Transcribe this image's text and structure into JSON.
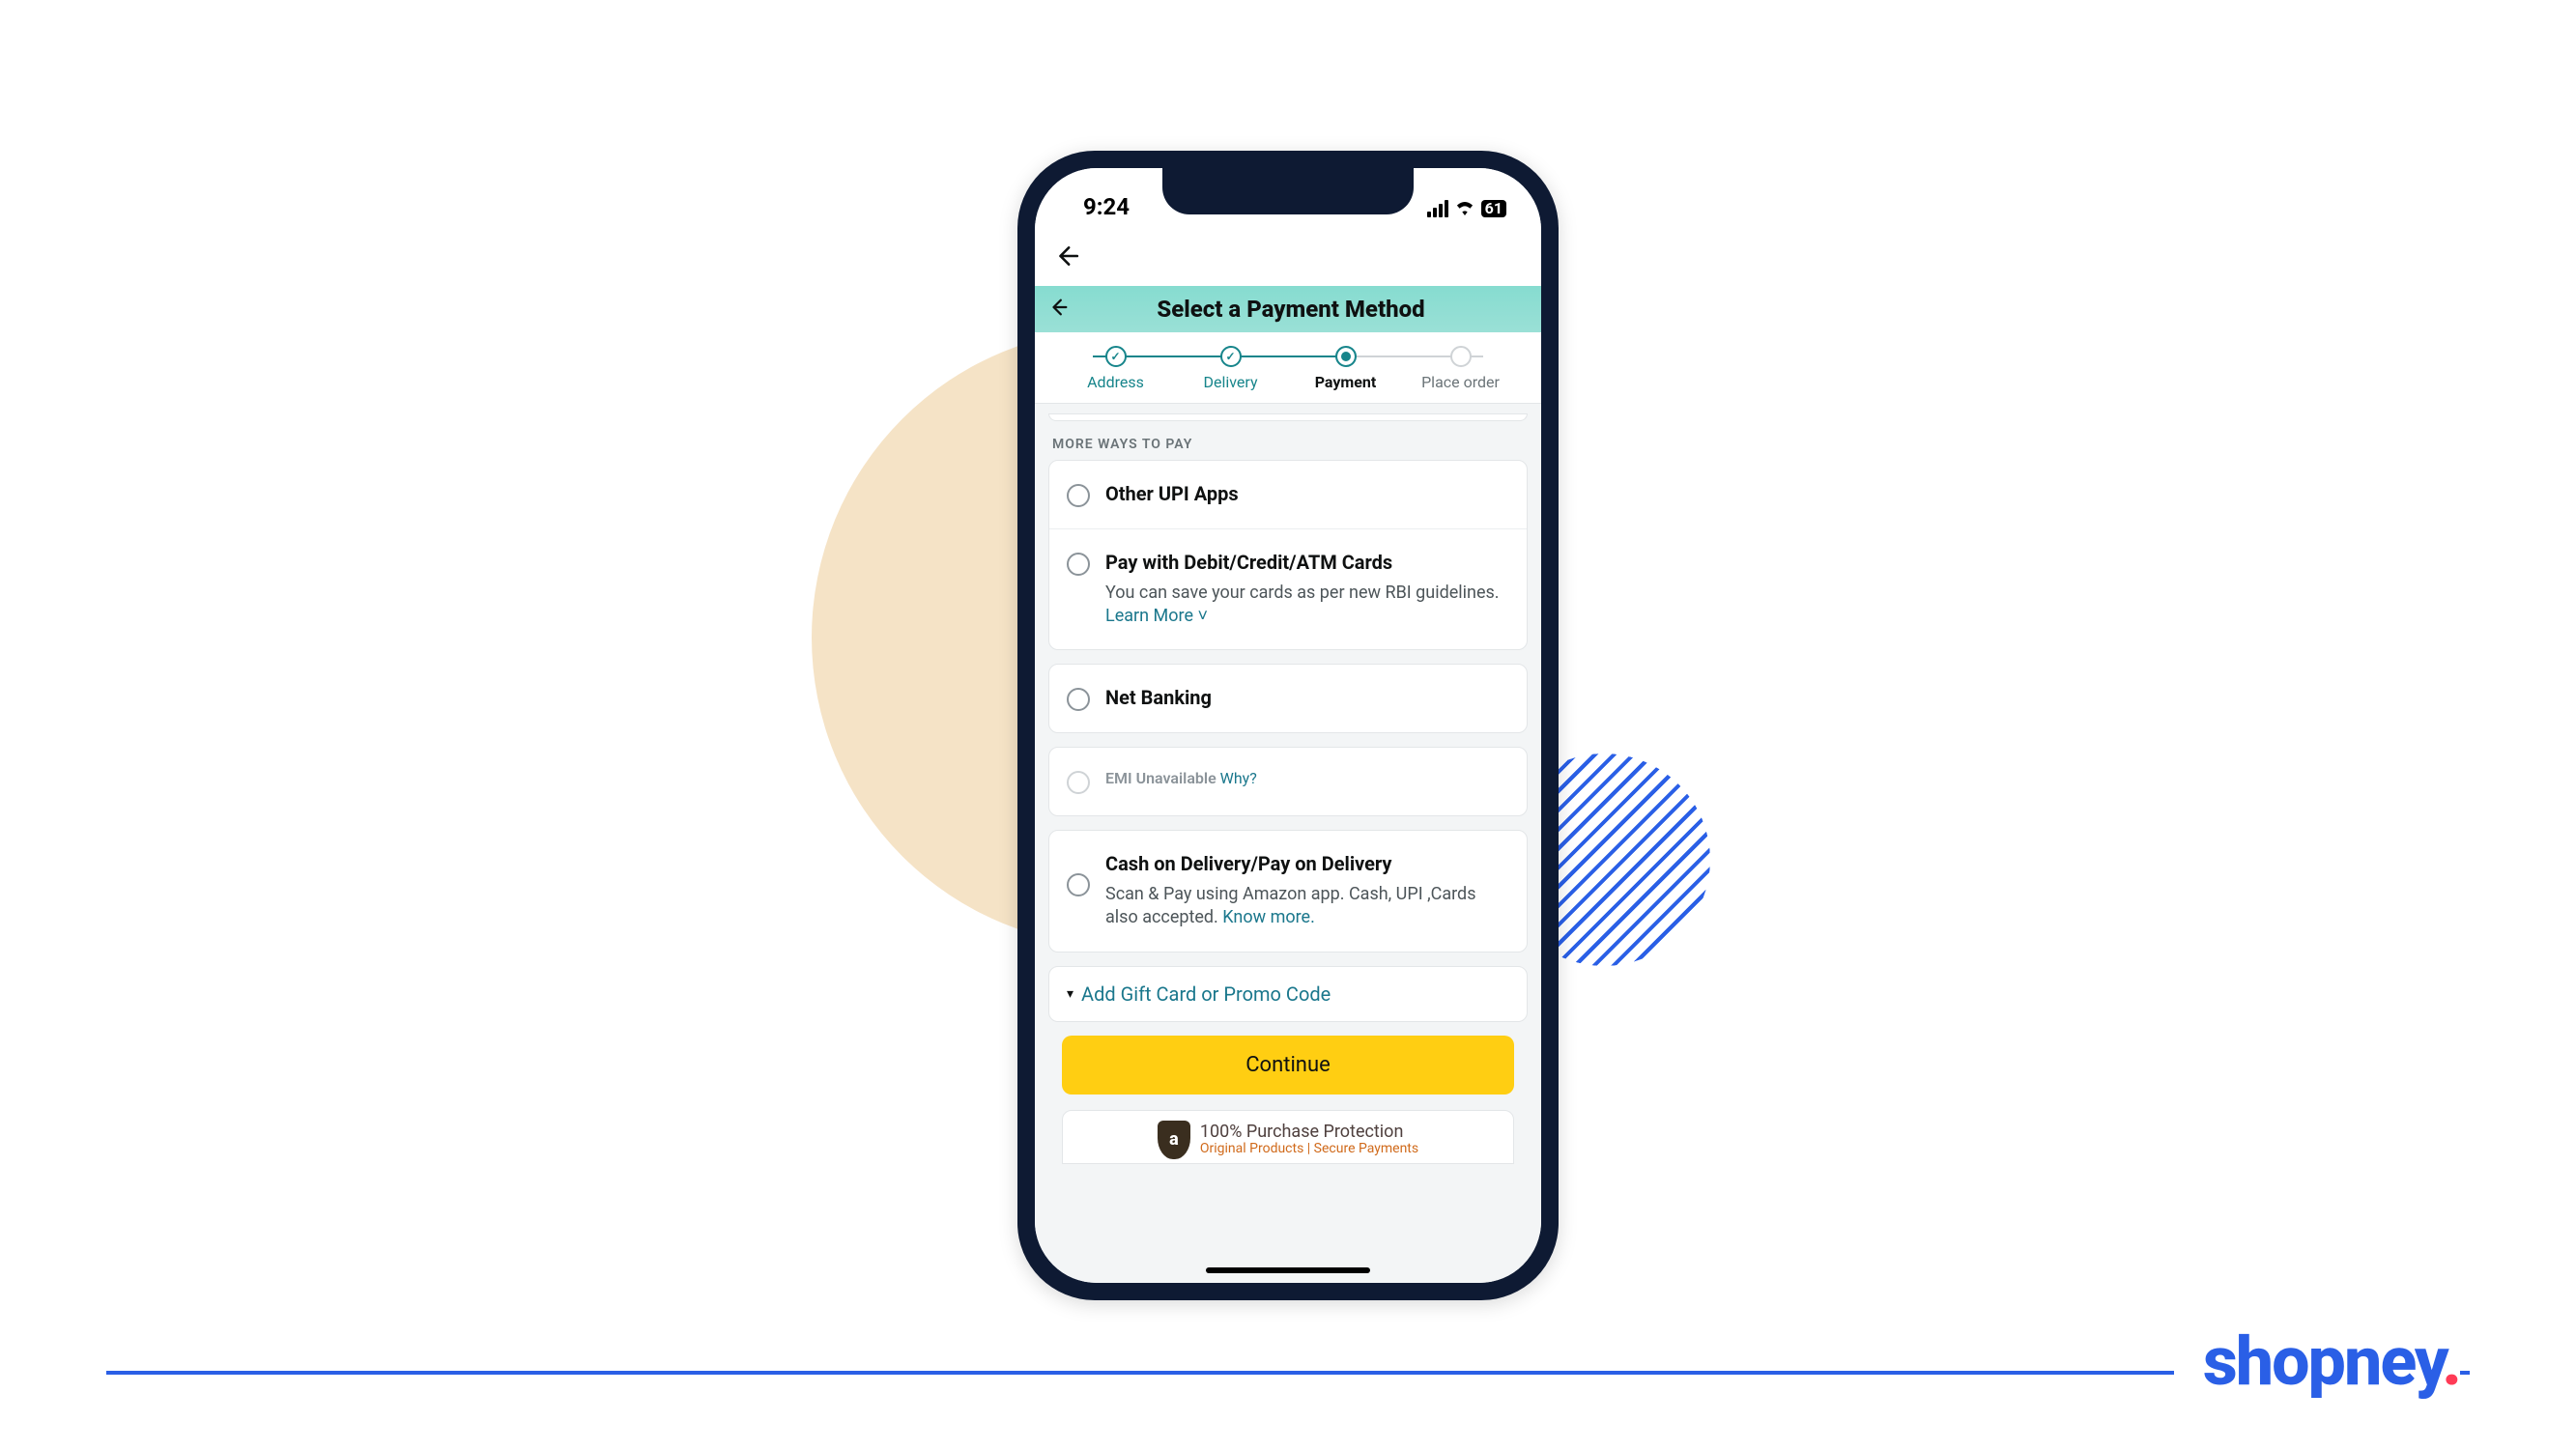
{
  "brand": {
    "name": "shopney"
  },
  "statusbar": {
    "time": "9:24",
    "battery": "61"
  },
  "page": {
    "title": "Select a Payment Method",
    "steps": [
      {
        "label": "Address",
        "state": "done"
      },
      {
        "label": "Delivery",
        "state": "done"
      },
      {
        "label": "Payment",
        "state": "current"
      },
      {
        "label": "Place order",
        "state": "future"
      }
    ],
    "section_heading": "MORE WAYS TO PAY",
    "options": {
      "upi": {
        "title": "Other UPI Apps"
      },
      "cards": {
        "title": "Pay with Debit/Credit/ATM Cards",
        "sub": "You can save your cards as per new RBI guidelines.",
        "link": "Learn More"
      },
      "netbanking": {
        "title": "Net Banking"
      },
      "emi": {
        "title": "EMI Unavailable",
        "link": "Why?"
      },
      "cod": {
        "title": "Cash on Delivery/Pay on Delivery",
        "sub": "Scan & Pay using Amazon app. Cash, UPI ,Cards also accepted.",
        "link": "Know more."
      }
    },
    "promo_link": "Add Gift Card or Promo Code",
    "continue_label": "Continue",
    "protection": {
      "main": "100% Purchase Protection",
      "sub": "Original Products | Secure Payments"
    }
  }
}
